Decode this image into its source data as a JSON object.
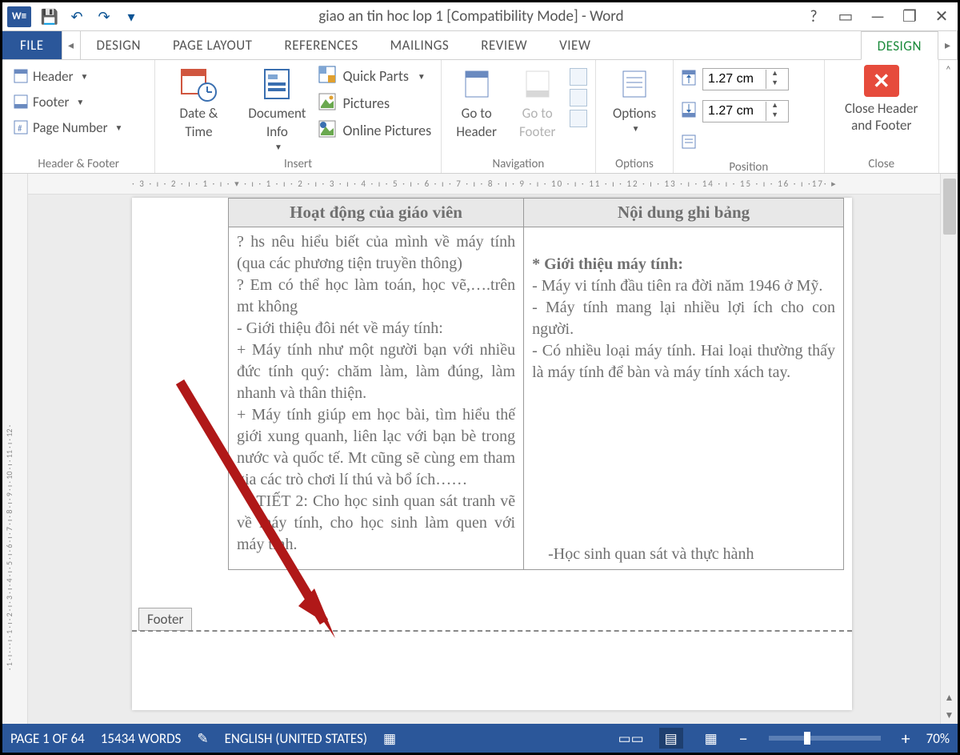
{
  "title": "giao an tin hoc lop 1 [Compatibility Mode] - Word",
  "qat": {
    "save": "💾",
    "undo": "↶",
    "redo": "↷",
    "customize": "▾"
  },
  "window": {
    "help": "?",
    "ribbon_opts": "▭",
    "minimize": "—",
    "restore": "❐",
    "close": "✕"
  },
  "tabs": {
    "file": "FILE",
    "list": [
      "DESIGN",
      "PAGE LAYOUT",
      "REFERENCES",
      "MAILINGS",
      "REVIEW",
      "VIEW"
    ],
    "active": "DESIGN"
  },
  "ribbon": {
    "hf": {
      "group": "Header & Footer",
      "header": "Header",
      "footer": "Footer",
      "pagenum": "Page Number"
    },
    "insert": {
      "group": "Insert",
      "datetime_a": "Date &",
      "datetime_b": "Time",
      "docinfo_a": "Document",
      "docinfo_b": "Info",
      "quickparts": "Quick Parts",
      "pictures": "Pictures",
      "onlinepics": "Online Pictures"
    },
    "nav": {
      "group": "Navigation",
      "goto_header_a": "Go to",
      "goto_header_b": "Header",
      "goto_footer_a": "Go to",
      "goto_footer_b": "Footer"
    },
    "options": {
      "group": "Options",
      "label": "Options"
    },
    "position": {
      "group": "Position",
      "top": "1.27 cm",
      "bottom": "1.27 cm"
    },
    "close": {
      "group": "Close",
      "label_a": "Close Header",
      "label_b": "and Footer"
    }
  },
  "ruler": {
    "h": "· 3 · ı · 2 · ı · 1 · ı · ▾ · ı · 1 · ı · 2 · ı · 3 · ı · 4 · ı · 5 · ı · 6 · ı · 7 · ı · 8 · ı · 9 · ı · 10 · ı · 11 · ı · 12 · ı · 13 · ı · 14 · ı · 15 · ı · 16 · ı ·17· ▸"
  },
  "document": {
    "table": {
      "head_left": "Hoạt động của giáo viên",
      "head_right": "Nội dung ghi bảng",
      "left": "? hs nêu hiểu biết của mình về máy tính (qua các phương tiện truyền thông)\n? Em có thể học làm toán, học vẽ,….trên mt không\n- Giới thiệu đôi nét về máy tính:\n+ Máy tính như một người bạn với nhiều đức tính quý: chăm làm, làm đúng, làm nhanh và thân thiện.\n+ Máy tính giúp em học bài, tìm hiểu thế giới xung quanh, liên lạc với bạn bè trong nước và quốc tế. Mt cũng sẽ cùng em tham gia các trò chơi lí thú và bổ ích……\n    TIẾT 2: Cho học sinh quan sát tranh vẽ về máy tính, cho học sinh làm quen với máy tính.",
      "right_top": "* Giới thiệu máy tính:\n- Máy vi tính đầu tiên ra đời năm 1946 ở Mỹ.\n- Máy tính mang lại nhiều lợi ích cho con người.\n- Có nhiều loại máy tính. Hai loại thường thấy là máy tính để bàn và máy tính xách tay.",
      "right_bottom": "    -Học sinh quan sát và thực hành"
    },
    "footer_tab": "Footer"
  },
  "status": {
    "page": "PAGE 1 OF 64",
    "words": "15434 WORDS",
    "lang": "ENGLISH (UNITED STATES)",
    "zoom": "70%"
  }
}
